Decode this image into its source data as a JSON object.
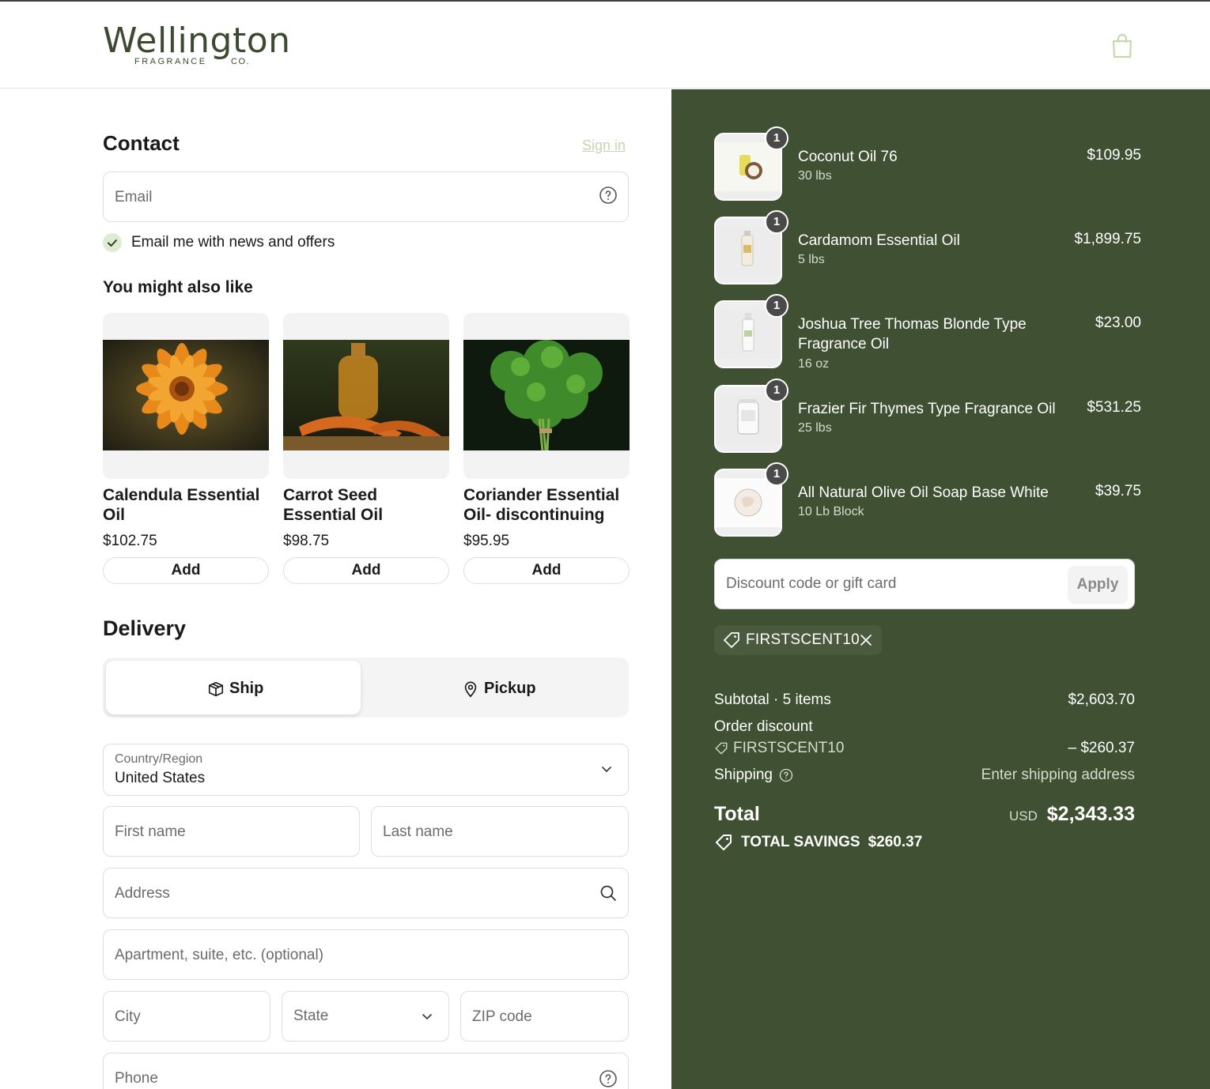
{
  "header": {
    "logo_word": "Wellington",
    "logo_sub": "FRAGRANCE",
    "logo_co": "CO."
  },
  "contact": {
    "title": "Contact",
    "sign_in": "Sign in",
    "email_placeholder": "Email",
    "newsletter_label": "Email me with news and offers",
    "newsletter_checked": true
  },
  "recommendations": {
    "title": "You might also like",
    "products": [
      {
        "name": "Calendula Essential Oil",
        "price": "$102.75",
        "add_label": "Add"
      },
      {
        "name": "Carrot Seed Essential Oil",
        "price": "$98.75",
        "add_label": "Add"
      },
      {
        "name": "Coriander Essential Oil- discontinuing",
        "price": "$95.95",
        "add_label": "Add"
      }
    ]
  },
  "delivery": {
    "title": "Delivery",
    "options": [
      {
        "label": "Ship",
        "selected": true
      },
      {
        "label": "Pickup",
        "selected": false
      }
    ],
    "country_label": "Country/Region",
    "country_value": "United States",
    "first_name_placeholder": "First name",
    "last_name_placeholder": "Last name",
    "address_placeholder": "Address",
    "apartment_placeholder": "Apartment, suite, etc. (optional)",
    "city_placeholder": "City",
    "state_placeholder": "State",
    "zip_placeholder": "ZIP code",
    "phone_placeholder": "Phone"
  },
  "order": {
    "items": [
      {
        "name": "Coconut Oil 76",
        "variant": "30 lbs",
        "price": "$109.95",
        "qty": "1"
      },
      {
        "name": "Cardamom Essential Oil",
        "variant": "5 lbs",
        "price": "$1,899.75",
        "qty": "1"
      },
      {
        "name": "Joshua Tree Thomas Blonde Type Fragrance Oil",
        "variant": "16 oz",
        "price": "$23.00",
        "qty": "1"
      },
      {
        "name": "Frazier Fir Thymes Type Fragrance Oil",
        "variant": "25 lbs",
        "price": "$531.25",
        "qty": "1"
      },
      {
        "name": "All Natural Olive Oil Soap Base White",
        "variant": "10 Lb Block",
        "price": "$39.75",
        "qty": "1"
      }
    ],
    "discount_placeholder": "Discount code or gift card",
    "apply_label": "Apply",
    "applied_code": "FIRSTSCENT10",
    "subtotal_label": "Subtotal · 5 items",
    "subtotal_value": "$2,603.70",
    "order_discount_label": "Order discount",
    "order_discount_code": "FIRSTSCENT10",
    "order_discount_value": "– $260.37",
    "shipping_label": "Shipping",
    "shipping_value": "Enter shipping address",
    "total_label": "Total",
    "currency": "USD",
    "total_value": "$2,343.33",
    "savings_label": "TOTAL SAVINGS",
    "savings_value": "$260.37"
  },
  "colors": {
    "summary_bg": "#3f5132",
    "brand": "#3b4a30",
    "check_bg": "#dfead3"
  }
}
